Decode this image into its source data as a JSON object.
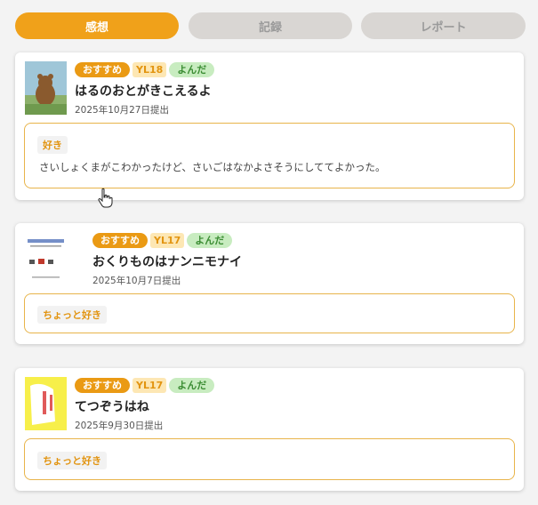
{
  "tabs": [
    {
      "label": "感想",
      "active": true
    },
    {
      "label": "記録",
      "active": false
    },
    {
      "label": "レポート",
      "active": false
    }
  ],
  "colors": {
    "accent": "#f0a11a",
    "inactive_tab": "#d9d6d3",
    "border": "#e8b44a"
  },
  "cards": [
    {
      "cover_title": "はるのおとが きこえるよ",
      "badges": {
        "recommend": "おすすめ",
        "level": "YL18",
        "status": "よんだ"
      },
      "title": "はるのおとがきこえるよ",
      "date": "2025年10月27日提出",
      "tag": "好き",
      "comment": "さいしょくまがこわかったけど、さいごはなかよさそうにしててよかった。"
    },
    {
      "cover_title": "おくりものはナンニモナイ",
      "badges": {
        "recommend": "おすすめ",
        "level": "YL17",
        "status": "よんだ"
      },
      "title": "おくりものはナンニモナイ",
      "date": "2025年10月7日提出",
      "tag": "ちょっと好き",
      "comment": ""
    },
    {
      "cover_title": "てつぞうはね",
      "badges": {
        "recommend": "おすすめ",
        "level": "YL17",
        "status": "よんだ"
      },
      "title": "てつぞうはね",
      "date": "2025年9月30日提出",
      "tag": "ちょっと好き",
      "comment": ""
    }
  ],
  "icons": {
    "cursor": "hand-pointer-icon"
  }
}
